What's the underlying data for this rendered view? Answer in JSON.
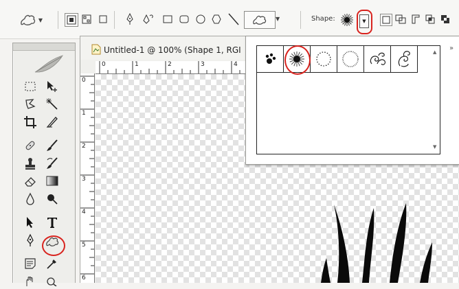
{
  "options_bar": {
    "shape_label": "Shape:",
    "tool_preset_icon": "custom-shape-preset-icon",
    "path_modes": [
      "shape-layers-icon",
      "paths-icon",
      "fill-pixels-icon"
    ],
    "shape_tools": [
      "pen-icon",
      "freeform-pen-icon",
      "rectangle-icon",
      "rounded-rectangle-icon",
      "ellipse-icon",
      "polygon-icon",
      "line-icon",
      "custom-shape-icon"
    ],
    "combine_modes": [
      "new-shape-icon",
      "add-icon",
      "subtract-icon",
      "intersect-icon",
      "exclude-icon"
    ]
  },
  "document": {
    "title": "Untitled-1 @ 100% (Shape 1, RGI",
    "ruler_h": [
      "0",
      "1",
      "2",
      "3",
      "4"
    ],
    "ruler_v": [
      "0",
      "1",
      "2",
      "3",
      "4",
      "5",
      "6"
    ]
  },
  "shape_picker": {
    "shapes": [
      "paw-print-shape",
      "starburst-shape-selected",
      "dotted-circle-shape",
      "dotted-circle-shape-2",
      "swirl-shape",
      "double-swirl-shape"
    ],
    "selected_index": 1,
    "menu_label": "»",
    "scroll_up": "▲",
    "scroll_down": "▼"
  },
  "colors": {
    "highlight": "#d8231e",
    "canvas_checker": "#e2e2e2"
  }
}
